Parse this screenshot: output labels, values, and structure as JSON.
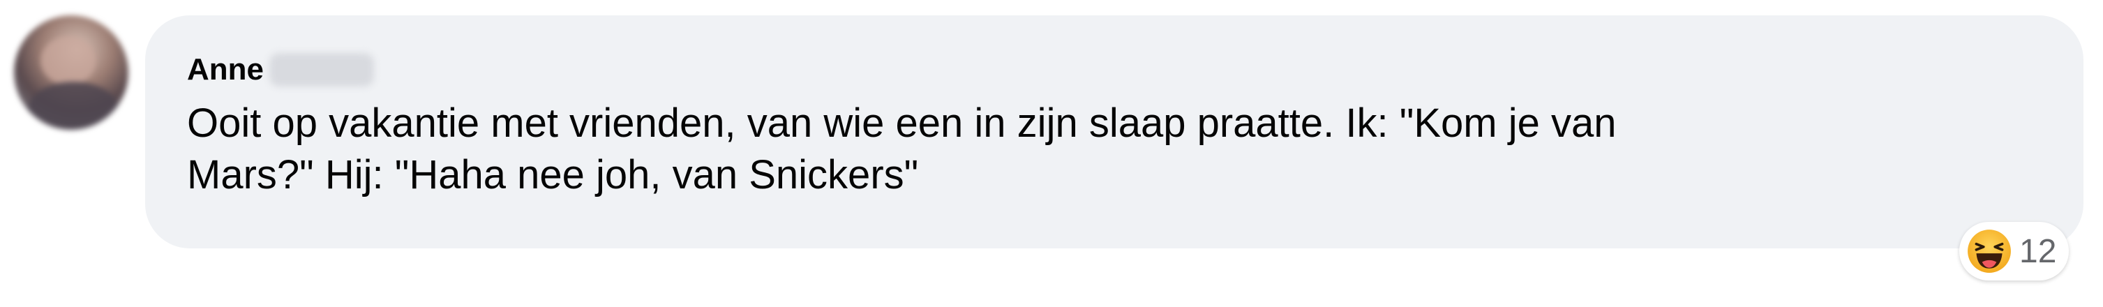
{
  "comment": {
    "author_first_name": "Anne",
    "text": "Ooit op vakantie met vrienden, van wie een in zijn slaap praatte. Ik: \"Kom je van\nMars?\" Hij: \"Haha nee joh, van Snickers\"",
    "reaction": {
      "icon": "haha-emoji-icon",
      "count": "12"
    }
  },
  "colors": {
    "bubble_bg": "#f0f2f5",
    "text": "#050505",
    "count_text": "#65676b",
    "emoji_face": "#f7b125"
  }
}
